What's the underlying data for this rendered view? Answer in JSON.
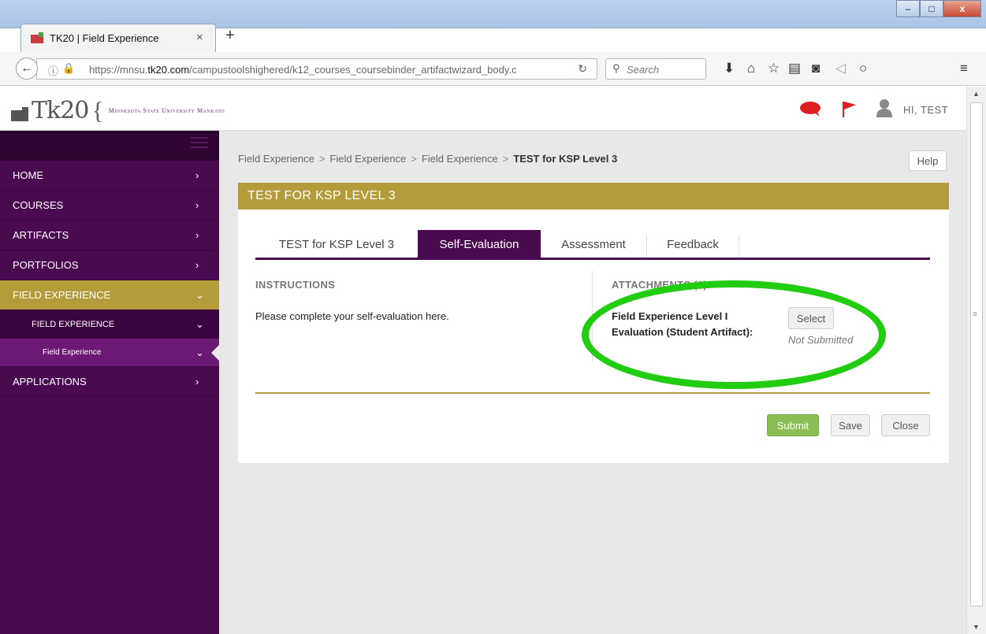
{
  "browser": {
    "tab_title": "TK20 | Field Experience",
    "tab_close": "×",
    "new_tab": "+",
    "url_host": "mnsu.tk20.com",
    "url_prefix": "https://mnsu.",
    "url_host_bold": "tk20.com",
    "url_path": "/campustoolshighered/k12_courses_coursebinder_artifactwizard_body.c",
    "search_placeholder": "Search",
    "window_min": "–",
    "window_max": "□",
    "window_close": "x"
  },
  "header": {
    "logo_text": "Tk20",
    "logo_brace": "{",
    "university": "Minnesota State University Mankato",
    "greeting": "HI, TEST"
  },
  "sidebar": {
    "items": [
      {
        "label": "HOME",
        "chev": "›"
      },
      {
        "label": "COURSES",
        "chev": "›"
      },
      {
        "label": "ARTIFACTS",
        "chev": "›"
      },
      {
        "label": "PORTFOLIOS",
        "chev": "›"
      },
      {
        "label": "FIELD EXPERIENCE",
        "chev": "⌄"
      },
      {
        "label": "FIELD EXPERIENCE",
        "chev": "⌄"
      },
      {
        "label": "Field Experience",
        "chev": "⌄"
      },
      {
        "label": "APPLICATIONS",
        "chev": "›"
      }
    ]
  },
  "breadcrumb": {
    "items": [
      "Field Experience",
      "Field Experience",
      "Field Experience"
    ],
    "separator": ">",
    "current": "TEST for KSP Level 3"
  },
  "help_label": "Help",
  "panel": {
    "title": "TEST FOR KSP LEVEL 3",
    "tabs": [
      {
        "label": "TEST for KSP Level 3"
      },
      {
        "label": "Self-Evaluation"
      },
      {
        "label": "Assessment"
      },
      {
        "label": "Feedback"
      }
    ],
    "active_tab": "Self-Evaluation",
    "instructions_title": "INSTRUCTIONS",
    "instructions_text": "Please complete your self-evaluation here.",
    "attachments_title": "ATTACHMENTS (0):",
    "attachment_label": "Field Experience Level I Evaluation (Student Artifact):",
    "select_label": "Select",
    "status": "Not Submitted",
    "buttons": {
      "submit": "Submit",
      "save": "Save",
      "close": "Close"
    }
  },
  "colors": {
    "purple": "#4a0a50",
    "gold": "#b49c3a",
    "submit_green": "#8bbd55",
    "annotation_green": "#22cc11"
  }
}
